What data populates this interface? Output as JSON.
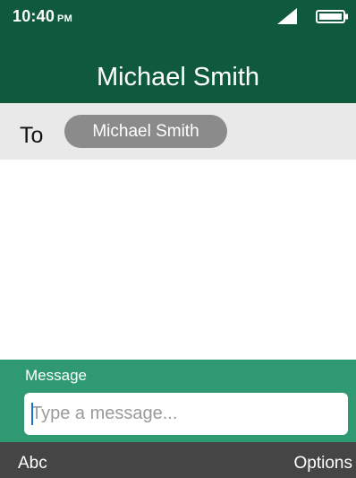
{
  "status_bar": {
    "time": "10:40",
    "ampm": "PM",
    "signal_icon": "signal-icon",
    "battery_icon": "battery-full-icon"
  },
  "header": {
    "title": "Michael Smith"
  },
  "recipient": {
    "to_label": "To",
    "chip_label": "Michael Smith"
  },
  "compose": {
    "label": "Message",
    "placeholder": "Type a message...",
    "value": ""
  },
  "softkeys": {
    "left": "Abc",
    "right": "Options"
  },
  "colors": {
    "header_bg": "#0f5a3c",
    "compose_bg": "#2f9a72",
    "softkey_bg": "#454545",
    "chip_bg": "#8b8b8b"
  }
}
